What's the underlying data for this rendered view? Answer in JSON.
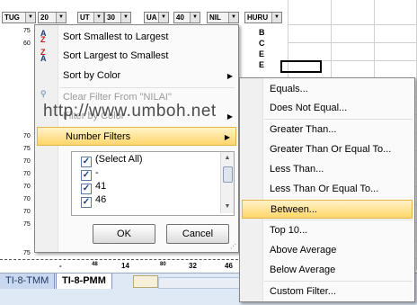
{
  "sheet": {
    "headers": [
      "TUG",
      "20",
      "UT",
      "30",
      "UA",
      "40",
      "NIL",
      "HURU"
    ],
    "left_col_values": [
      "75",
      "60",
      "70",
      "75",
      "70",
      "70",
      "70",
      "70",
      "70",
      "75",
      "75"
    ],
    "hurl_letters": [
      "B",
      "C",
      "E",
      "E"
    ],
    "bottom_values": [
      "-",
      "48",
      "14",
      "80",
      "32",
      "46"
    ],
    "tabs": [
      "TI-8-TMM",
      "TI-8-PMM"
    ]
  },
  "filter_menu": {
    "sort_asc": "Sort Smallest to Largest",
    "sort_desc": "Sort Largest to Smallest",
    "sort_color": "Sort by Color",
    "clear_filter": "Clear Filter From \"NILAI\"",
    "filter_color": "Filter by Color",
    "number_filters": "Number Filters",
    "checklist": [
      "(Select All)",
      "-",
      "41",
      "46"
    ],
    "ok": "OK",
    "cancel": "Cancel"
  },
  "submenu": {
    "items": [
      "Equals...",
      "Does Not Equal...",
      "Greater Than...",
      "Greater Than Or Equal To...",
      "Less Than...",
      "Less Than Or Equal To...",
      "Between...",
      "Top 10...",
      "Above Average",
      "Below Average",
      "Custom Filter..."
    ]
  },
  "watermark": "http://www.umboh.net"
}
